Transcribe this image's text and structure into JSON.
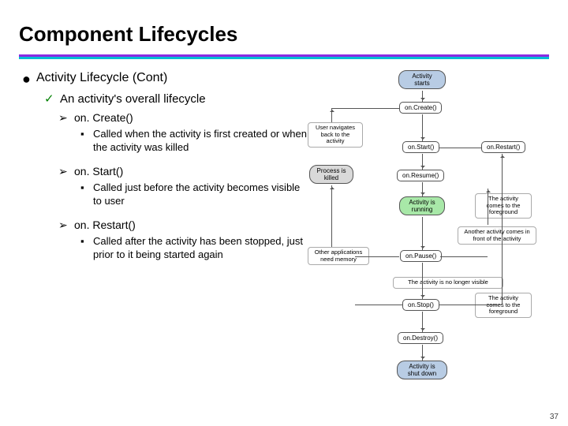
{
  "title": "Component Lifecycles",
  "page_number": "37",
  "bullets": {
    "l1": "Activity Lifecycle (Cont)",
    "l2": "An activity's overall lifecycle",
    "onCreate": {
      "label": "on. Create()",
      "desc": "Called when the activity is first created or when the activity was killed"
    },
    "onStart": {
      "label": "on. Start()",
      "desc": "Called just before the activity becomes visible to user"
    },
    "onRestart": {
      "label": "on. Restart()",
      "desc": "Called after the activity has been stopped, just prior to it being started again"
    }
  },
  "diagram": {
    "start": "Activity\nstarts",
    "onCreate": "on.Create()",
    "onStart": "on.Start()",
    "onResume": "on.Resume()",
    "running": "Activity is\nrunning",
    "onPause": "on.Pause()",
    "onStop": "on.Stop()",
    "onDestroy": "on.Destroy()",
    "onRestart": "on.Restart()",
    "shutdown": "Activity is\nshut down",
    "killed": "Process is\nkilled",
    "navBack": "User navigates\nback to the\nactivity",
    "foreground1": "The activity\ncomes to the\nforeground",
    "anotherFront": "Another activity comes\nin front of the activity",
    "otherMem": "Other applications\nneed memory",
    "noLonger": "The activity is no longer visible",
    "foreground2": "The activity\ncomes to the\nforeground"
  }
}
